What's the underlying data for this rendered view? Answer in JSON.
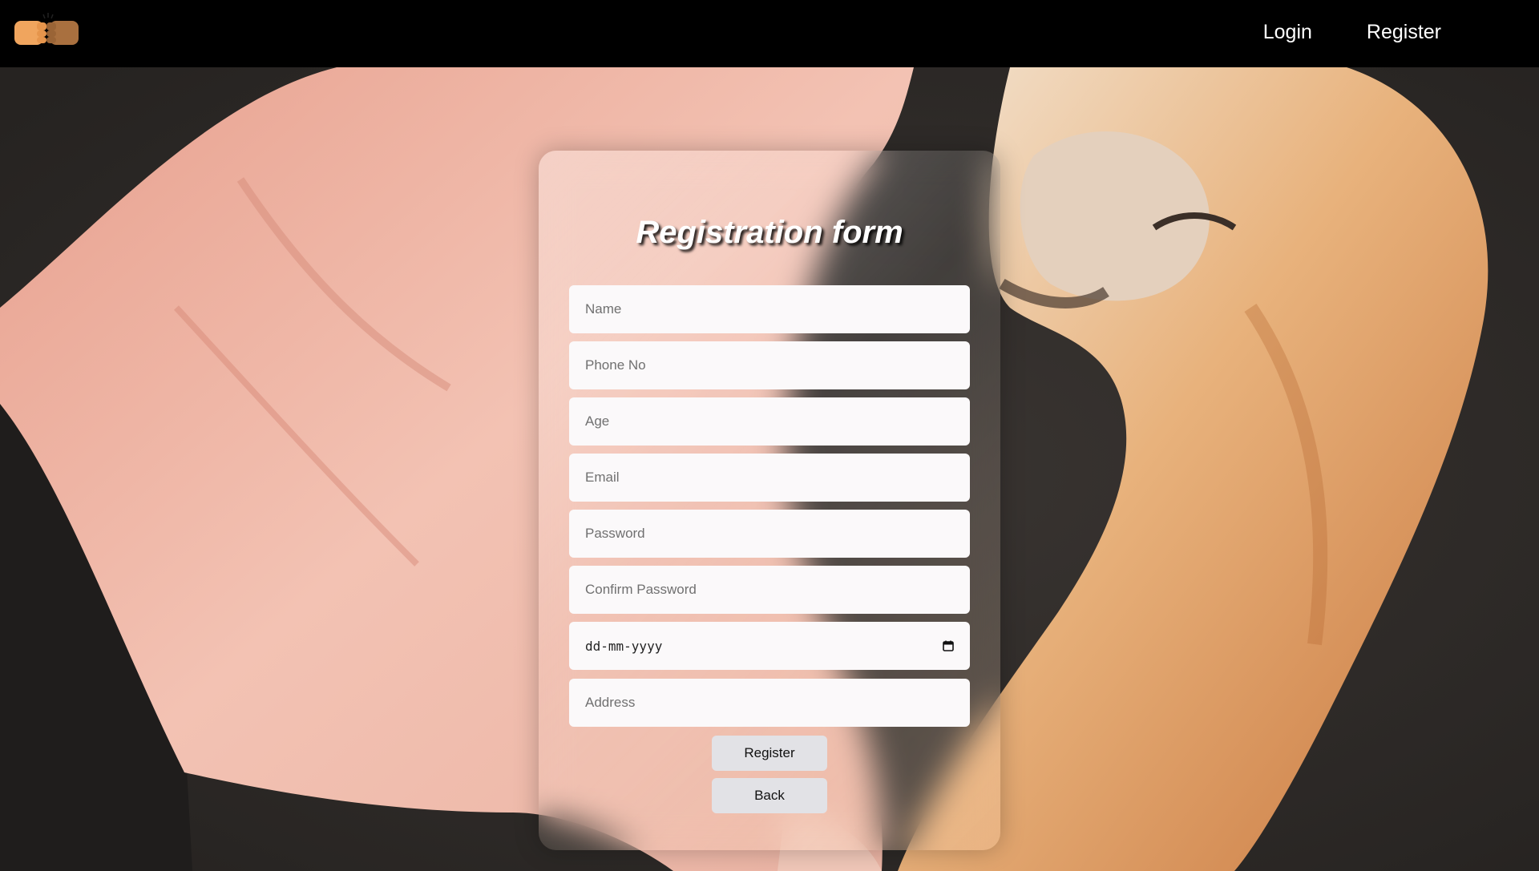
{
  "nav": {
    "logo_icon": "fist-bump-icon",
    "links": [
      "Login",
      "Register"
    ]
  },
  "form": {
    "title": "Registration form",
    "fields": {
      "name_placeholder": "Name",
      "phone_placeholder": "Phone No",
      "age_placeholder": "Age",
      "email_placeholder": "Email",
      "password_placeholder": "Password",
      "confirm_password_placeholder": "Confirm Password",
      "date_placeholder": "dd-mm-yyyy",
      "address_placeholder": "Address"
    },
    "buttons": {
      "register": "Register",
      "back": "Back"
    }
  },
  "colors": {
    "navbar": "#000000",
    "field_bg": "#fbf9fa",
    "button_bg": "#e2e2e6"
  }
}
